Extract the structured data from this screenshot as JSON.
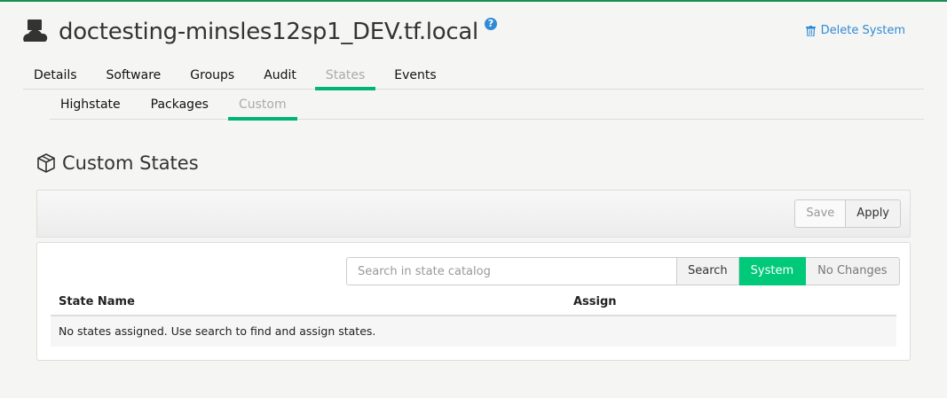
{
  "system": {
    "name": "doctesting-minsles12sp1_DEV.tf.local",
    "help_icon": "question-circle-icon",
    "delete_label": "Delete System"
  },
  "tabs": [
    {
      "label": "Details",
      "active": false
    },
    {
      "label": "Software",
      "active": false
    },
    {
      "label": "Groups",
      "active": false
    },
    {
      "label": "Audit",
      "active": false
    },
    {
      "label": "States",
      "active": true
    },
    {
      "label": "Events",
      "active": false
    }
  ],
  "subtabs": [
    {
      "label": "Highstate",
      "active": false
    },
    {
      "label": "Packages",
      "active": false
    },
    {
      "label": "Custom",
      "active": true
    }
  ],
  "section": {
    "title": "Custom States",
    "icon": "cube-icon"
  },
  "toolbar": {
    "save_label": "Save",
    "apply_label": "Apply"
  },
  "search": {
    "placeholder": "Search in state catalog",
    "value": "",
    "search_label": "Search",
    "system_label": "System",
    "no_changes_label": "No Changes"
  },
  "table": {
    "columns": [
      "State Name",
      "Assign"
    ],
    "empty_message": "No states assigned. Use search to find and assign states."
  },
  "colors": {
    "accent": "#00b573",
    "link": "#2e8bd6",
    "top_border": "#1c8d4f"
  }
}
